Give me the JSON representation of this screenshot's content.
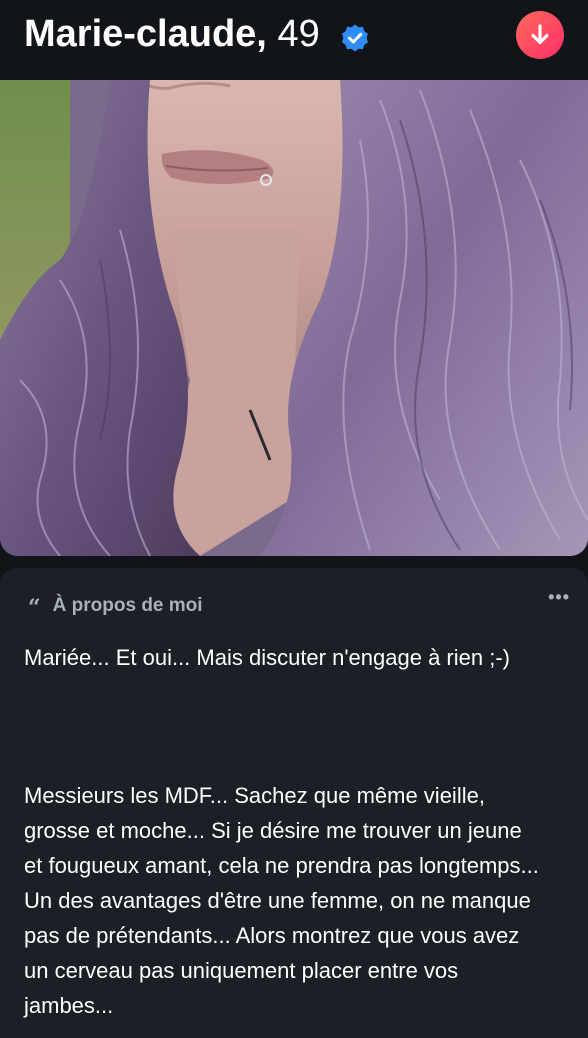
{
  "profile": {
    "name": "Marie-claude,",
    "age": "49",
    "verified_icon": "verified-check-icon",
    "action_icon": "arrow-down-icon",
    "accent_gradient": [
      "#ff6a5a",
      "#fd2e67"
    ],
    "verified_color": "#2f8cf2"
  },
  "about": {
    "title": "À propos de moi",
    "quote_icon": "“",
    "more_icon": "•••",
    "paragraphs": [
      "Mariée...  Et oui...  Mais discuter n'engage à rien ;-)",
      "Messieurs les MDF... Sachez que même vieille, grosse et moche... Si je désire me trouver un jeune et fougueux amant, cela ne prendra pas longtemps... Un des avantages d'être une femme, on ne manque pas de prétendants... Alors montrez que vous avez un cerveau pas uniquement placer entre vos jambes..."
    ]
  }
}
